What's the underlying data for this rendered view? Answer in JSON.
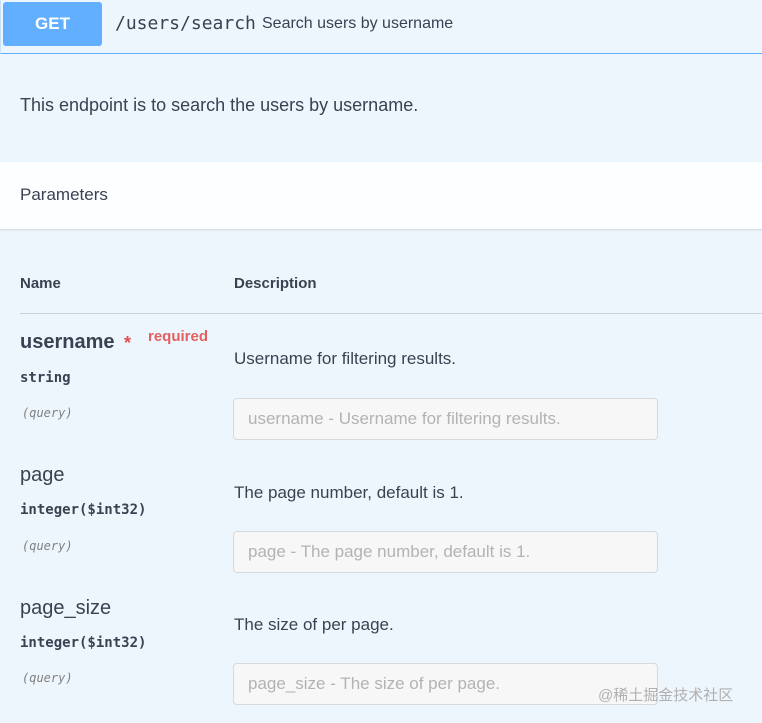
{
  "operation": {
    "method": "GET",
    "path": "/users/search",
    "summary": "Search users by username",
    "description": "This endpoint is to search the users by username.",
    "method_color": "#61affe"
  },
  "parameters_section": {
    "title": "Parameters",
    "columns": {
      "name": "Name",
      "description": "Description"
    }
  },
  "parameters": [
    {
      "name": "username",
      "required_star": "*",
      "required_label": "required",
      "type": "string",
      "in": "(query)",
      "description": "Username for filtering results.",
      "value": "",
      "placeholder": "username - Username for filtering results."
    },
    {
      "name": "page",
      "type": "integer($int32)",
      "in": "(query)",
      "description": "The page number, default is 1.",
      "value": "",
      "placeholder": "page - The page number, default is 1."
    },
    {
      "name": "page_size",
      "type": "integer($int32)",
      "in": "(query)",
      "description": "The size of per page.",
      "value": "",
      "placeholder": "page_size - The size of per page."
    }
  ],
  "watermark": "@稀土掘金技术社区"
}
